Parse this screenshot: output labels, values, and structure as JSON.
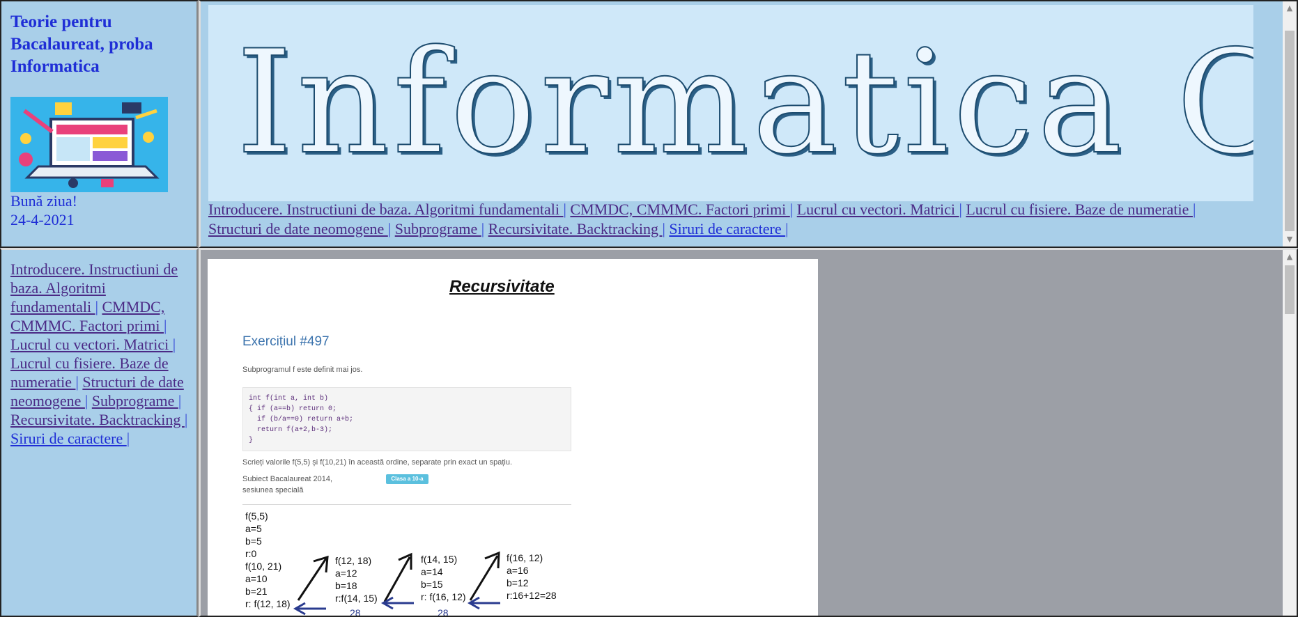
{
  "site": {
    "title": "Teorie pentru Bacalaureat, proba Informatica",
    "greeting": "Bună ziua!",
    "date": "24-4-2021"
  },
  "banner": {
    "title": "Informatica C++"
  },
  "nav": {
    "items": [
      "Introducere. Instructiuni de baza. Algoritmi fundamentali ",
      "CMMDC, CMMMC. Factori primi ",
      "Lucrul cu vectori. Matrici ",
      "Lucrul cu fisiere. Baze de numeratie ",
      "Structuri de date neomogene ",
      "Subprograme ",
      "Recursivitate. Backtracking ",
      "Siruri de caractere "
    ],
    "separator": "|"
  },
  "document": {
    "title": "Recursivitate",
    "exercise_title": "Exercițiul #497",
    "intro": "Subprogramul f este definit mai jos.",
    "code": "int f(int a, int b)\n{ if (a==b) return 0;\n  if (b/a==0) return a+b;\n  return f(a+2,b-3);\n}",
    "question": "Scrieți valorile f(5,5) și f(10,21) în această ordine, separate prin exact un spațiu.",
    "source_line1": "Subiect Bacalaureat 2014,",
    "source_line2": "sesiunea specială",
    "badge": "Clasa a 10-a",
    "trace1": "f(5,5)\na=5\nb=5\nr:0\nf(10, 21)\na=10\nb=21\nr: f(12, 18)",
    "trace2": "f(12, 18)\na=12\nb=18\nr:f(14, 15)",
    "trace3": "f(14, 15)\na=14\nb=15\nr: f(16, 12)",
    "trace4": "f(16, 12)\na=16\nb=12\nr:16+12=28",
    "ret1": "28",
    "ret2": "28"
  }
}
